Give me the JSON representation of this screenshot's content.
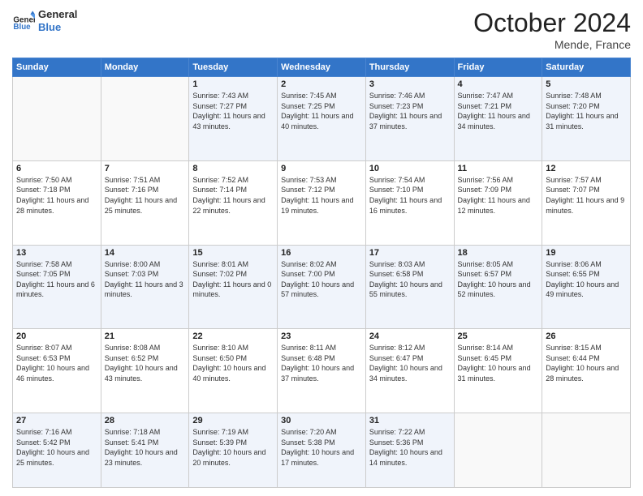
{
  "header": {
    "logo": {
      "line1": "General",
      "line2": "Blue"
    },
    "title": "October 2024",
    "location": "Mende, France"
  },
  "weekdays": [
    "Sunday",
    "Monday",
    "Tuesday",
    "Wednesday",
    "Thursday",
    "Friday",
    "Saturday"
  ],
  "weeks": [
    [
      {
        "day": "",
        "sunrise": "",
        "sunset": "",
        "daylight": ""
      },
      {
        "day": "",
        "sunrise": "",
        "sunset": "",
        "daylight": ""
      },
      {
        "day": "1",
        "sunrise": "Sunrise: 7:43 AM",
        "sunset": "Sunset: 7:27 PM",
        "daylight": "Daylight: 11 hours and 43 minutes."
      },
      {
        "day": "2",
        "sunrise": "Sunrise: 7:45 AM",
        "sunset": "Sunset: 7:25 PM",
        "daylight": "Daylight: 11 hours and 40 minutes."
      },
      {
        "day": "3",
        "sunrise": "Sunrise: 7:46 AM",
        "sunset": "Sunset: 7:23 PM",
        "daylight": "Daylight: 11 hours and 37 minutes."
      },
      {
        "day": "4",
        "sunrise": "Sunrise: 7:47 AM",
        "sunset": "Sunset: 7:21 PM",
        "daylight": "Daylight: 11 hours and 34 minutes."
      },
      {
        "day": "5",
        "sunrise": "Sunrise: 7:48 AM",
        "sunset": "Sunset: 7:20 PM",
        "daylight": "Daylight: 11 hours and 31 minutes."
      }
    ],
    [
      {
        "day": "6",
        "sunrise": "Sunrise: 7:50 AM",
        "sunset": "Sunset: 7:18 PM",
        "daylight": "Daylight: 11 hours and 28 minutes."
      },
      {
        "day": "7",
        "sunrise": "Sunrise: 7:51 AM",
        "sunset": "Sunset: 7:16 PM",
        "daylight": "Daylight: 11 hours and 25 minutes."
      },
      {
        "day": "8",
        "sunrise": "Sunrise: 7:52 AM",
        "sunset": "Sunset: 7:14 PM",
        "daylight": "Daylight: 11 hours and 22 minutes."
      },
      {
        "day": "9",
        "sunrise": "Sunrise: 7:53 AM",
        "sunset": "Sunset: 7:12 PM",
        "daylight": "Daylight: 11 hours and 19 minutes."
      },
      {
        "day": "10",
        "sunrise": "Sunrise: 7:54 AM",
        "sunset": "Sunset: 7:10 PM",
        "daylight": "Daylight: 11 hours and 16 minutes."
      },
      {
        "day": "11",
        "sunrise": "Sunrise: 7:56 AM",
        "sunset": "Sunset: 7:09 PM",
        "daylight": "Daylight: 11 hours and 12 minutes."
      },
      {
        "day": "12",
        "sunrise": "Sunrise: 7:57 AM",
        "sunset": "Sunset: 7:07 PM",
        "daylight": "Daylight: 11 hours and 9 minutes."
      }
    ],
    [
      {
        "day": "13",
        "sunrise": "Sunrise: 7:58 AM",
        "sunset": "Sunset: 7:05 PM",
        "daylight": "Daylight: 11 hours and 6 minutes."
      },
      {
        "day": "14",
        "sunrise": "Sunrise: 8:00 AM",
        "sunset": "Sunset: 7:03 PM",
        "daylight": "Daylight: 11 hours and 3 minutes."
      },
      {
        "day": "15",
        "sunrise": "Sunrise: 8:01 AM",
        "sunset": "Sunset: 7:02 PM",
        "daylight": "Daylight: 11 hours and 0 minutes."
      },
      {
        "day": "16",
        "sunrise": "Sunrise: 8:02 AM",
        "sunset": "Sunset: 7:00 PM",
        "daylight": "Daylight: 10 hours and 57 minutes."
      },
      {
        "day": "17",
        "sunrise": "Sunrise: 8:03 AM",
        "sunset": "Sunset: 6:58 PM",
        "daylight": "Daylight: 10 hours and 55 minutes."
      },
      {
        "day": "18",
        "sunrise": "Sunrise: 8:05 AM",
        "sunset": "Sunset: 6:57 PM",
        "daylight": "Daylight: 10 hours and 52 minutes."
      },
      {
        "day": "19",
        "sunrise": "Sunrise: 8:06 AM",
        "sunset": "Sunset: 6:55 PM",
        "daylight": "Daylight: 10 hours and 49 minutes."
      }
    ],
    [
      {
        "day": "20",
        "sunrise": "Sunrise: 8:07 AM",
        "sunset": "Sunset: 6:53 PM",
        "daylight": "Daylight: 10 hours and 46 minutes."
      },
      {
        "day": "21",
        "sunrise": "Sunrise: 8:08 AM",
        "sunset": "Sunset: 6:52 PM",
        "daylight": "Daylight: 10 hours and 43 minutes."
      },
      {
        "day": "22",
        "sunrise": "Sunrise: 8:10 AM",
        "sunset": "Sunset: 6:50 PM",
        "daylight": "Daylight: 10 hours and 40 minutes."
      },
      {
        "day": "23",
        "sunrise": "Sunrise: 8:11 AM",
        "sunset": "Sunset: 6:48 PM",
        "daylight": "Daylight: 10 hours and 37 minutes."
      },
      {
        "day": "24",
        "sunrise": "Sunrise: 8:12 AM",
        "sunset": "Sunset: 6:47 PM",
        "daylight": "Daylight: 10 hours and 34 minutes."
      },
      {
        "day": "25",
        "sunrise": "Sunrise: 8:14 AM",
        "sunset": "Sunset: 6:45 PM",
        "daylight": "Daylight: 10 hours and 31 minutes."
      },
      {
        "day": "26",
        "sunrise": "Sunrise: 8:15 AM",
        "sunset": "Sunset: 6:44 PM",
        "daylight": "Daylight: 10 hours and 28 minutes."
      }
    ],
    [
      {
        "day": "27",
        "sunrise": "Sunrise: 7:16 AM",
        "sunset": "Sunset: 5:42 PM",
        "daylight": "Daylight: 10 hours and 25 minutes."
      },
      {
        "day": "28",
        "sunrise": "Sunrise: 7:18 AM",
        "sunset": "Sunset: 5:41 PM",
        "daylight": "Daylight: 10 hours and 23 minutes."
      },
      {
        "day": "29",
        "sunrise": "Sunrise: 7:19 AM",
        "sunset": "Sunset: 5:39 PM",
        "daylight": "Daylight: 10 hours and 20 minutes."
      },
      {
        "day": "30",
        "sunrise": "Sunrise: 7:20 AM",
        "sunset": "Sunset: 5:38 PM",
        "daylight": "Daylight: 10 hours and 17 minutes."
      },
      {
        "day": "31",
        "sunrise": "Sunrise: 7:22 AM",
        "sunset": "Sunset: 5:36 PM",
        "daylight": "Daylight: 10 hours and 14 minutes."
      },
      {
        "day": "",
        "sunrise": "",
        "sunset": "",
        "daylight": ""
      },
      {
        "day": "",
        "sunrise": "",
        "sunset": "",
        "daylight": ""
      }
    ]
  ]
}
